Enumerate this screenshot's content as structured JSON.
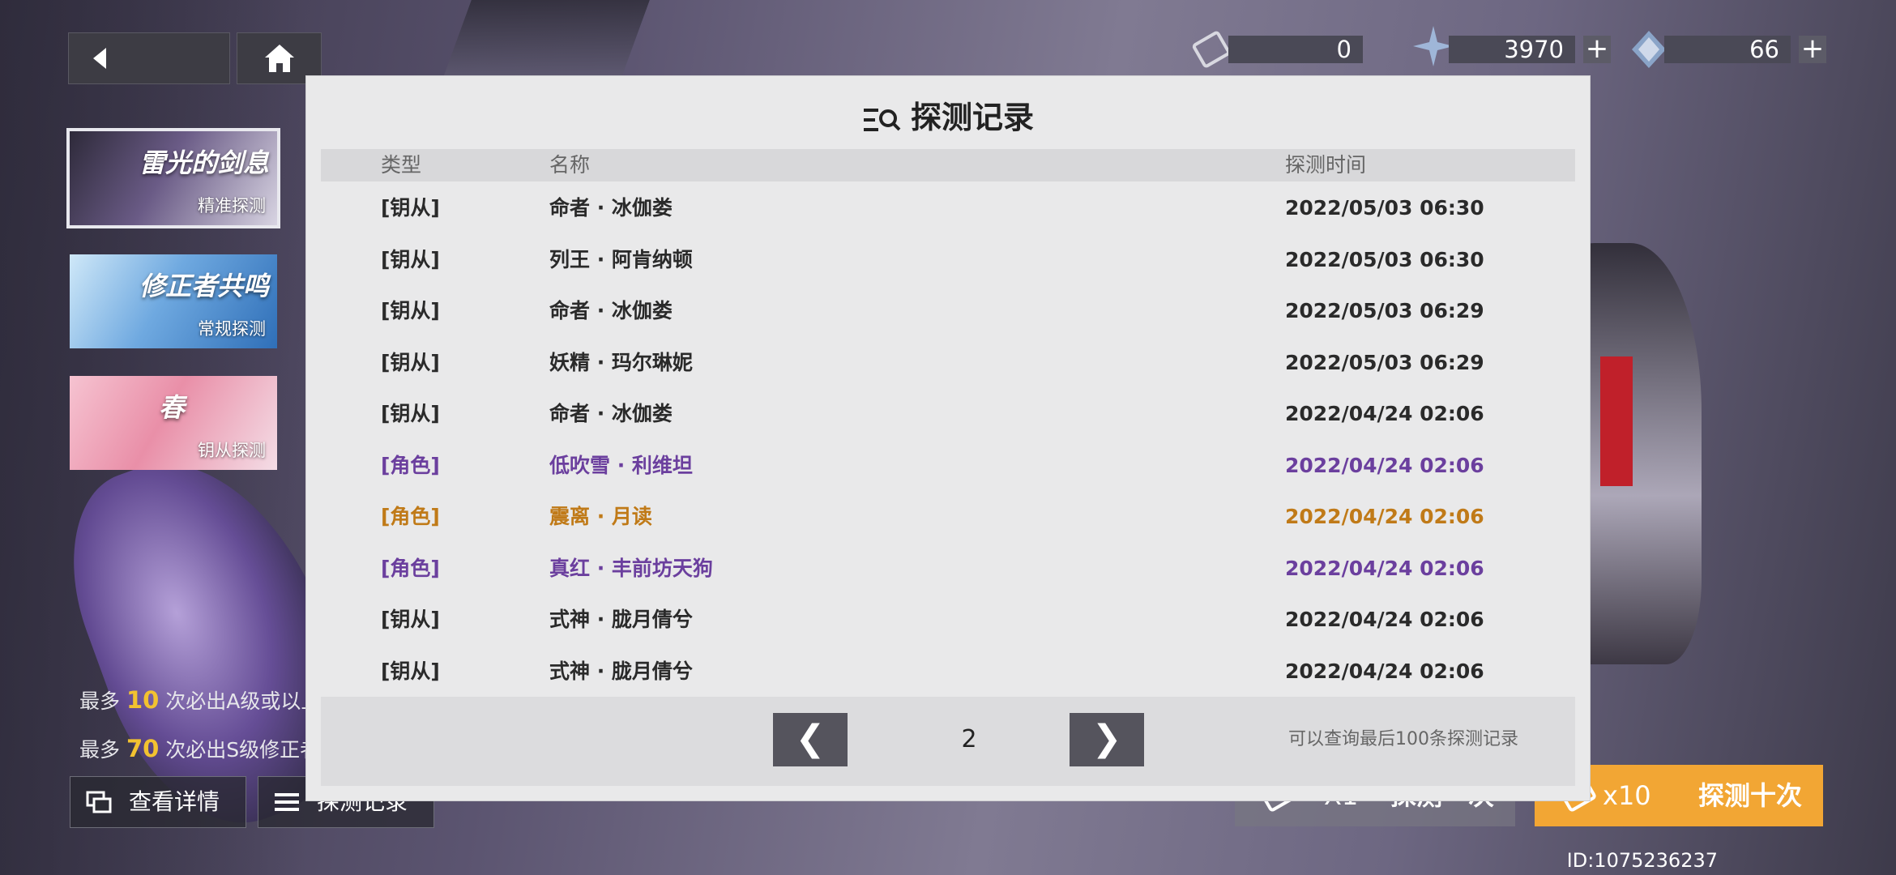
{
  "colors": {
    "purple_rank": "#6b3f9e",
    "orange_rank": "#c07a18",
    "default_text": "#2a2a2a",
    "accent_yellow": "#f2c230",
    "draw10_bg": "#f2a634"
  },
  "top": {
    "back_icon": "back-arrow-icon",
    "home_icon": "home-icon",
    "currencies": [
      {
        "icon": "ticket-icon",
        "value": "0",
        "has_plus": false
      },
      {
        "icon": "crystal-icon",
        "value": "3970",
        "plus": "+"
      },
      {
        "icon": "gem-icon",
        "value": "66",
        "plus": "+"
      }
    ]
  },
  "banners": [
    {
      "title": "雷光的剑息",
      "subtitle": "精准探测",
      "selected": true
    },
    {
      "title": "修正者共鸣",
      "subtitle": "常规探测",
      "selected": false
    },
    {
      "title": "春",
      "subtitle": "钥从探测",
      "selected": false
    }
  ],
  "rules": {
    "rule1_prefix": "最多",
    "rule1_num": "10",
    "rule1_suffix": "次必出A级或以上品质钥从",
    "rule2_prefix": "最多",
    "rule2_num": "70",
    "rule2_suffix": "次必出S级修正者"
  },
  "bottom": {
    "details_label": "查看详情",
    "records_label": "探测记录",
    "draw1_count": "X1",
    "draw1_label": "探测一次",
    "draw10_count": "x10",
    "draw10_label": "探测十次",
    "uid": "ID:1075236237"
  },
  "modal": {
    "title": "探测记录",
    "columns": {
      "type": "类型",
      "name": "名称",
      "time": "探测时间"
    },
    "rows": [
      {
        "type": "[钥从]",
        "name": "命者 · 冰伽娄",
        "time": "2022/05/03 06:30",
        "rank": "normal"
      },
      {
        "type": "[钥从]",
        "name": "列王 · 阿肯纳顿",
        "time": "2022/05/03 06:30",
        "rank": "normal"
      },
      {
        "type": "[钥从]",
        "name": "命者 · 冰伽娄",
        "time": "2022/05/03 06:29",
        "rank": "normal"
      },
      {
        "type": "[钥从]",
        "name": "妖精 · 玛尔琳妮",
        "time": "2022/05/03 06:29",
        "rank": "normal"
      },
      {
        "type": "[钥从]",
        "name": "命者 · 冰伽娄",
        "time": "2022/04/24 02:06",
        "rank": "normal"
      },
      {
        "type": "[角色]",
        "name": "低吹雪 · 利维坦",
        "time": "2022/04/24 02:06",
        "rank": "purple"
      },
      {
        "type": "[角色]",
        "name": "震离 · 月读",
        "time": "2022/04/24 02:06",
        "rank": "orange"
      },
      {
        "type": "[角色]",
        "name": "真红 · 丰前坊天狗",
        "time": "2022/04/24 02:06",
        "rank": "purple"
      },
      {
        "type": "[钥从]",
        "name": "式神 · 胧月倩兮",
        "time": "2022/04/24 02:06",
        "rank": "normal"
      },
      {
        "type": "[钥从]",
        "name": "式神 · 胧月倩兮",
        "time": "2022/04/24 02:06",
        "rank": "normal"
      }
    ],
    "pagination": {
      "prev": "❮",
      "page": "2",
      "next": "❯"
    },
    "note": "可以查询最后100条探测记录"
  }
}
